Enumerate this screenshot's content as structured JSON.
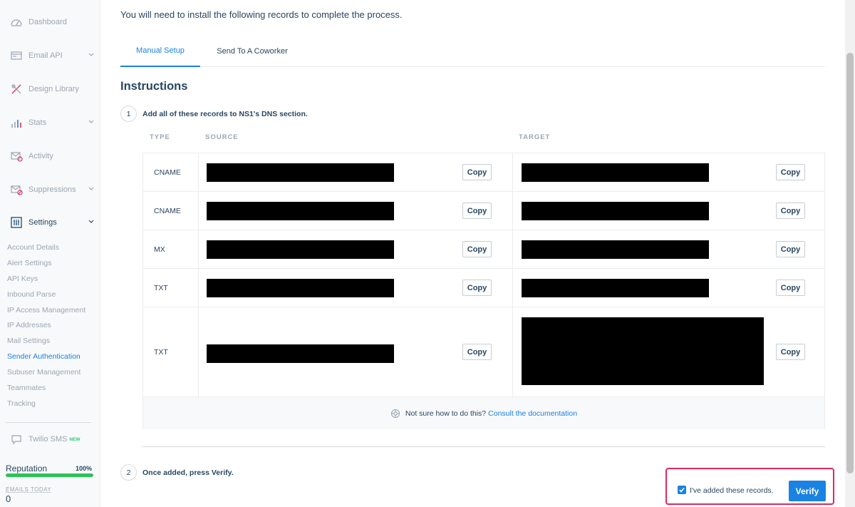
{
  "sidebar": {
    "nav": [
      {
        "label": "Dashboard",
        "icon": "dashboard-icon",
        "chevron": false
      },
      {
        "label": "Email API",
        "icon": "email-api-icon",
        "chevron": true
      },
      {
        "label": "Design Library",
        "icon": "design-library-icon",
        "chevron": false
      },
      {
        "label": "Stats",
        "icon": "stats-icon",
        "chevron": true
      },
      {
        "label": "Activity",
        "icon": "activity-icon",
        "chevron": false
      },
      {
        "label": "Suppressions",
        "icon": "suppressions-icon",
        "chevron": true
      },
      {
        "label": "Settings",
        "icon": "settings-icon",
        "chevron": true
      }
    ],
    "settings_items": [
      "Account Details",
      "Alert Settings",
      "API Keys",
      "Inbound Parse",
      "IP Access Management",
      "IP Addresses",
      "Mail Settings",
      "Sender Authentication",
      "Subuser Management",
      "Teammates",
      "Tracking"
    ],
    "active_item": "Sender Authentication",
    "twilio": {
      "label": "Twilio SMS",
      "badge": "NEW",
      "icon": "chat-icon"
    },
    "reputation": {
      "label": "Reputation",
      "percent_text": "100%",
      "percent": 100
    },
    "emails_today": {
      "label": "EMAILS TODAY",
      "count": "0"
    }
  },
  "main": {
    "intro": "You will need to install the following records to complete the process.",
    "tabs": [
      {
        "label": "Manual Setup",
        "active": true
      },
      {
        "label": "Send To A Coworker",
        "active": false
      }
    ],
    "heading": "Instructions",
    "step1": {
      "number": "1",
      "text": "Add all of these records to NS1's DNS section."
    },
    "columns": {
      "type": "TYPE",
      "source": "SOURCE",
      "target": "TARGET"
    },
    "records": [
      {
        "type": "CNAME",
        "source": "[redacted]",
        "target": "[redacted]"
      },
      {
        "type": "CNAME",
        "source": "[redacted]",
        "target": "[redacted]"
      },
      {
        "type": "MX",
        "source": "[redacted]",
        "target": "[redacted]"
      },
      {
        "type": "TXT",
        "source": "[redacted]",
        "target": "[redacted]"
      },
      {
        "type": "TXT",
        "source": "[redacted]",
        "target": "[redacted]"
      }
    ],
    "copy_label": "Copy",
    "help": {
      "text": "Not sure how to do this?",
      "link": "Consult the documentation",
      "icon": "lifebuoy-icon"
    },
    "step2": {
      "number": "2",
      "text": "Once added, press Verify."
    },
    "confirm": {
      "label": "I've added these records.",
      "checked": true
    },
    "verify_label": "Verify"
  },
  "colors": {
    "accent": "#1a82e2",
    "text": "#294661",
    "highlight": "#e0285a",
    "success": "#2cc25a"
  }
}
